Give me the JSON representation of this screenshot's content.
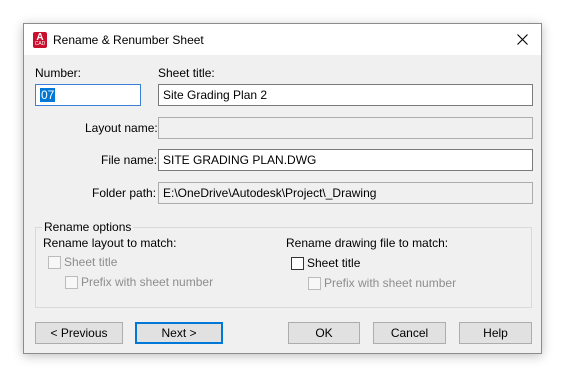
{
  "window": {
    "title": "Rename & Renumber Sheet",
    "app_icon": {
      "glyph": "A",
      "sub": "CAD"
    },
    "close_glyph": "close-icon"
  },
  "form": {
    "number_label": "Number:",
    "number_value": "07",
    "sheet_title_label": "Sheet title:",
    "sheet_title_value": "Site Grading Plan 2",
    "layout_name_label": "Layout name:",
    "layout_name_value": "",
    "file_name_label": "File name:",
    "file_name_value": "SITE GRADING PLAN.DWG",
    "folder_path_label": "Folder path:",
    "folder_path_value": "E:\\OneDrive\\Autodesk\\Project\\_Drawing"
  },
  "rename_options": {
    "legend": "Rename options",
    "layout_heading": "Rename layout to match:",
    "layout_sheet_title": {
      "label": "Sheet title",
      "checked": false,
      "enabled": false
    },
    "layout_prefix": {
      "label": "Prefix with sheet number",
      "checked": false,
      "enabled": false
    },
    "drawing_heading": "Rename drawing file to match:",
    "drawing_sheet_title": {
      "label": "Sheet title",
      "checked": false,
      "enabled": true
    },
    "drawing_prefix": {
      "label": "Prefix with sheet number",
      "checked": false,
      "enabled": false
    }
  },
  "buttons": {
    "previous": "< Previous",
    "next": "Next >",
    "ok": "OK",
    "cancel": "Cancel",
    "help": "Help"
  },
  "colors": {
    "accent": "#0078d7",
    "app_icon": "#c8102e",
    "dialog_bg": "#f0f0f0"
  }
}
